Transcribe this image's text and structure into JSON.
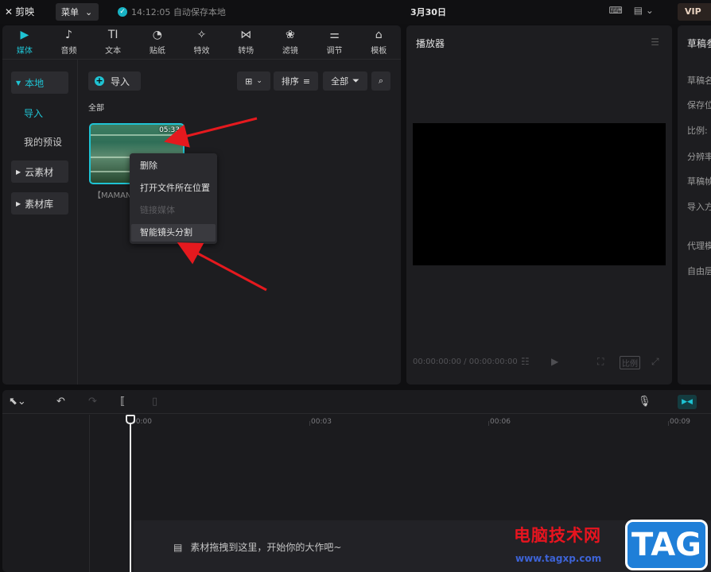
{
  "app": {
    "logo_text": "剪映",
    "menu_label": "菜单",
    "save_status": "14:12:05 自动保存本地",
    "date": "3月30日",
    "vip_label": "VIP"
  },
  "media_tabs": [
    {
      "label": "媒体",
      "icon": "media-icon",
      "glyph": "▶"
    },
    {
      "label": "音频",
      "icon": "audio-icon",
      "glyph": "♪"
    },
    {
      "label": "文本",
      "icon": "text-icon",
      "glyph": "TI"
    },
    {
      "label": "贴纸",
      "icon": "sticker-icon",
      "glyph": "◔"
    },
    {
      "label": "特效",
      "icon": "effects-icon",
      "glyph": "✧"
    },
    {
      "label": "转场",
      "icon": "transition-icon",
      "glyph": "⋈"
    },
    {
      "label": "滤镜",
      "icon": "filter-icon",
      "glyph": "❀"
    },
    {
      "label": "调节",
      "icon": "adjust-icon",
      "glyph": "⚌"
    },
    {
      "label": "模板",
      "icon": "template-icon",
      "glyph": "⌂"
    }
  ],
  "side_nav": {
    "local": "本地",
    "import": "导入",
    "my_presets": "我的预设",
    "cloud": "云素材",
    "library": "素材库"
  },
  "library_toolbar": {
    "import_label": "导入",
    "sort_label": "排序",
    "filter_label": "全部"
  },
  "library": {
    "section_label": "全部",
    "clip_duration": "05:33",
    "clip_caption": "【MAMAN"
  },
  "context_menu": [
    "删除",
    "打开文件所在位置",
    "链接媒体",
    "智能镜头分割"
  ],
  "player": {
    "title": "播放器",
    "timecode": "00:00:00:00 / 00:00:00:00",
    "ratio_label": "比例"
  },
  "draft": {
    "title": "草稿参数",
    "rows": [
      "草稿名",
      "保存位",
      "比例:",
      "分辨率",
      "草稿帧",
      "导入方",
      "代理模",
      "自由层"
    ]
  },
  "timeline": {
    "ruler": [
      "00:00",
      "00:03",
      "00:06",
      "00:09"
    ],
    "drop_hint": "素材拖拽到这里，开始你的大作吧~"
  },
  "watermark": {
    "title": "电脑技术网",
    "url": "www.tagxp.com",
    "tag": "TAG"
  },
  "colors": {
    "accent": "#1fc3d3",
    "annotation_arrow": "#e5191e"
  }
}
